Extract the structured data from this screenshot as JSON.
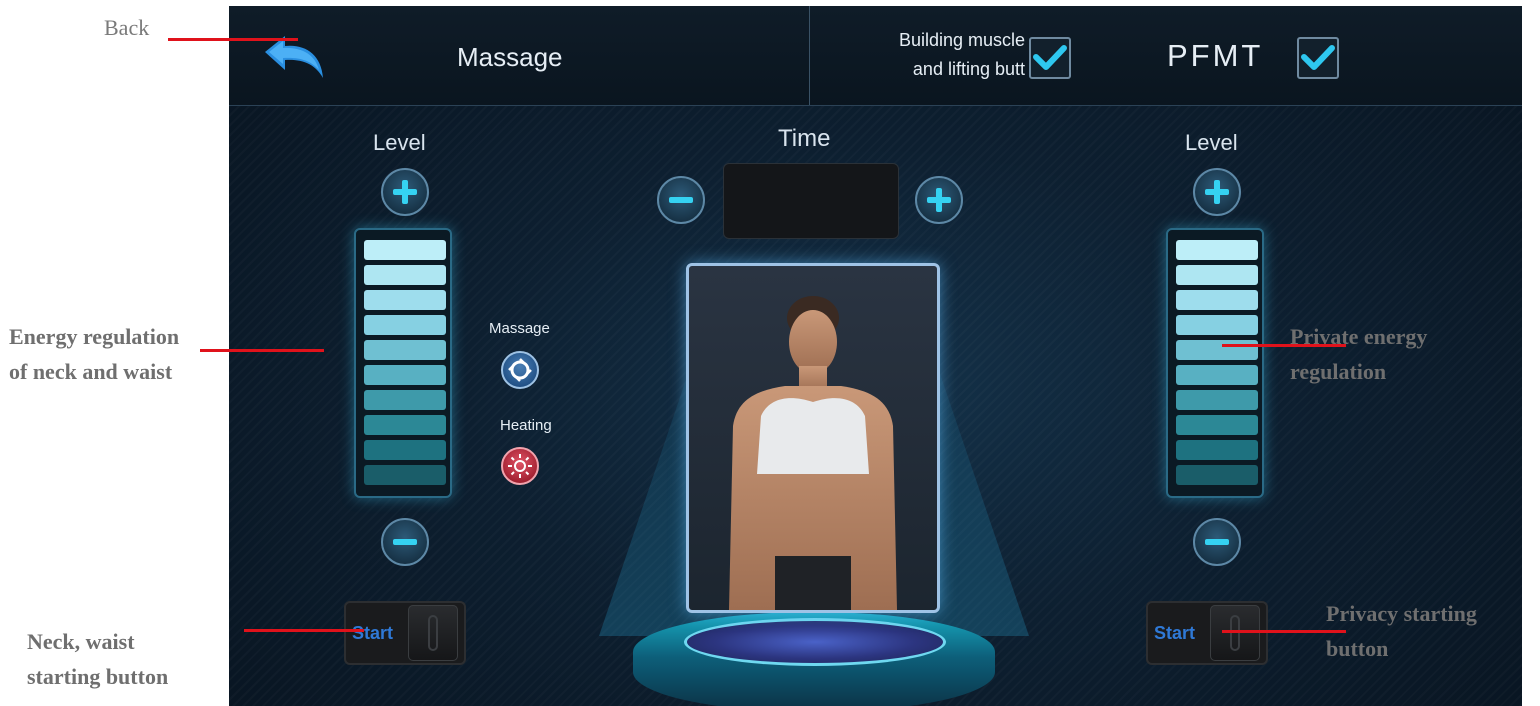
{
  "header": {
    "mode_title": "Massage",
    "option1_line1": "Building muscle",
    "option1_line2": "and lifting butt",
    "option1_checked": true,
    "option2_label": "PFMT",
    "option2_checked": true
  },
  "left_panel": {
    "level_label": "Level",
    "start_label": "Start"
  },
  "right_panel": {
    "level_label": "Level",
    "start_label": "Start"
  },
  "time": {
    "label": "Time",
    "value": ""
  },
  "side_controls": {
    "massage_label": "Massage",
    "heating_label": "Heating"
  },
  "annotations": {
    "back": "Back",
    "neck_waist_line1": "Energy regulation",
    "neck_waist_line2": "of neck and waist",
    "private_line1": "Private energy",
    "private_line2": "regulation",
    "neck_start_line1": "Neck, waist",
    "neck_start_line2": "starting button",
    "privacy_start_line1": "Privacy starting",
    "privacy_start_line2": "button"
  },
  "colors": {
    "accent_cyan": "#25b8e8",
    "checkmark": "#2ec7ef",
    "annotation_line": "#e0121b",
    "start_text": "#2f79d6"
  },
  "icons": [
    "back-arrow-icon",
    "check-icon",
    "plus-icon",
    "minus-icon",
    "massage-icon",
    "sun-icon",
    "model-photo"
  ]
}
